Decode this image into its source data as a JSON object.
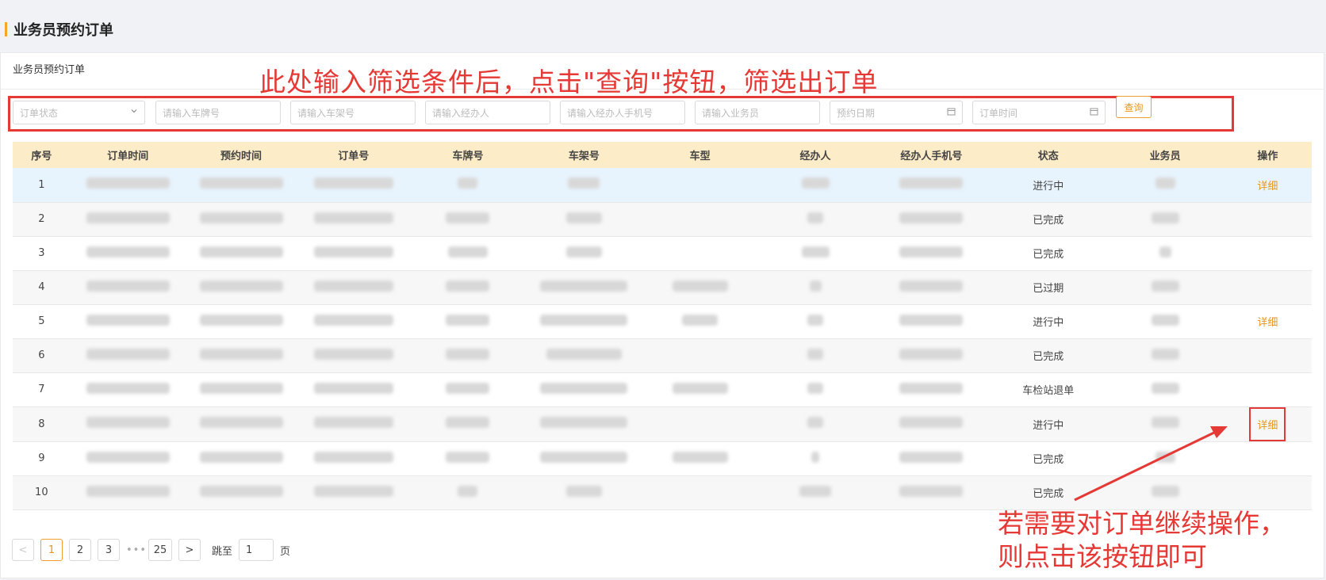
{
  "page": {
    "title": "业务员预约订单"
  },
  "card": {
    "title": "业务员预约订单"
  },
  "annotations": {
    "top": "此处输入筛选条件后，点击\"查询\"按钮，筛选出订单",
    "bottom_line1": "若需要对订单继续操作，",
    "bottom_line2": "则点击该按钮即可"
  },
  "filters": {
    "status_placeholder": "订单状态",
    "plate_placeholder": "请输入车牌号",
    "vin_placeholder": "请输入车架号",
    "agent_placeholder": "请输入经办人",
    "agent_phone_placeholder": "请输入经办人手机号",
    "salesman_placeholder": "请输入业务员",
    "appointment_date_placeholder": "预约日期",
    "order_time_placeholder": "订单时间",
    "query_label": "查询"
  },
  "table": {
    "headers": [
      "序号",
      "订单时间",
      "预约时间",
      "订单号",
      "车牌号",
      "车架号",
      "车型",
      "经办人",
      "经办人手机号",
      "状态",
      "业务员",
      "操作"
    ],
    "rows": [
      {
        "no": "1",
        "status": "进行中",
        "action": "详细"
      },
      {
        "no": "2",
        "status": "已完成",
        "action": ""
      },
      {
        "no": "3",
        "status": "已完成",
        "action": ""
      },
      {
        "no": "4",
        "status": "已过期",
        "action": ""
      },
      {
        "no": "5",
        "status": "进行中",
        "action": "详细"
      },
      {
        "no": "6",
        "status": "已完成",
        "action": ""
      },
      {
        "no": "7",
        "status": "车检站退单",
        "action": ""
      },
      {
        "no": "8",
        "status": "进行中",
        "action": "详细"
      },
      {
        "no": "9",
        "status": "已完成",
        "action": ""
      },
      {
        "no": "10",
        "status": "已完成",
        "action": ""
      }
    ]
  },
  "pagination": {
    "prev": "<",
    "pages": [
      "1",
      "2",
      "3"
    ],
    "ellipsis": "•••",
    "last": "25",
    "next": ">",
    "jump_label": "跳至",
    "jump_value": "1",
    "page_suffix": "页"
  },
  "colors": {
    "accent": "#e8961c",
    "header_bg": "#fdecc8",
    "annotation": "#e53935",
    "highlight_row": "#e8f4fd"
  }
}
